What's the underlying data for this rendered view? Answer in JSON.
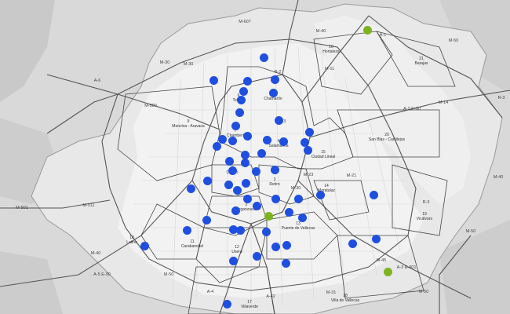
{
  "colors": {
    "background": "#d9d9d9",
    "park_area": "#c9c9c9",
    "urban_area": "#f2f2f2",
    "district_border": "#444444",
    "marker_blue": "#1f4fe0",
    "marker_green": "#7cb41f"
  },
  "districts": [
    {
      "num": "1",
      "name": "Centro"
    },
    {
      "num": "2",
      "name": "Arganzuela"
    },
    {
      "num": "3",
      "name": "Retiro"
    },
    {
      "num": "4",
      "name": "Salamanca"
    },
    {
      "num": "5",
      "name": "Chamartín"
    },
    {
      "num": "6",
      "name": "Tetuán"
    },
    {
      "num": "7",
      "name": "Chamberí"
    },
    {
      "num": "9",
      "name": "Moncloa - Aravaca"
    },
    {
      "num": "10",
      "name": "Latina"
    },
    {
      "num": "11",
      "name": "Carabanchel"
    },
    {
      "num": "12",
      "name": "Usera"
    },
    {
      "num": "13",
      "name": "Puente de Vallecas"
    },
    {
      "num": "14",
      "name": "Moratalaz"
    },
    {
      "num": "15",
      "name": "Ciudad Lineal"
    },
    {
      "num": "16",
      "name": "Hortaleza"
    },
    {
      "num": "17",
      "name": "Villaverde"
    },
    {
      "num": "18",
      "name": "Villa de Vallecas"
    },
    {
      "num": "19",
      "name": "Vicálvaro"
    },
    {
      "num": "20",
      "name": "San Blas - Canillejas"
    },
    {
      "num": "21",
      "name": "Barajas"
    }
  ],
  "roads": [
    "A-6",
    "M-30",
    "M-500",
    "M-607",
    "M-40",
    "A-1",
    "M-11",
    "A-2 E-90",
    "M-14",
    "M-21",
    "R-3",
    "A-3",
    "M-23",
    "M-40",
    "R-3",
    "M-50",
    "M-511",
    "M-501",
    "M-40",
    "A-5 E-90",
    "A-42",
    "A-4",
    "A-3 E-901",
    "M-31",
    "M-30",
    "M-50",
    "M-45",
    "M-50",
    "R-2",
    "M-50",
    "M-30"
  ],
  "marker_counts": {
    "blue": 64,
    "green": 3
  }
}
